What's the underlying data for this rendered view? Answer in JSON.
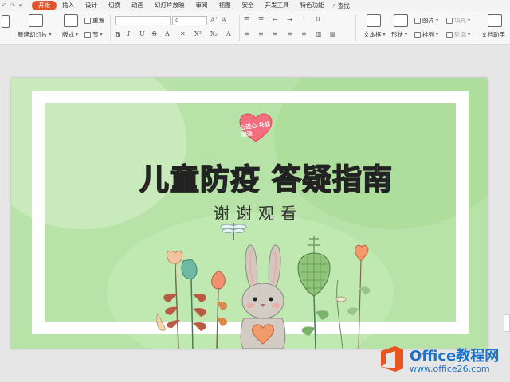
{
  "menubar": {
    "tabs": [
      "开始",
      "插入",
      "设计",
      "切换",
      "动画",
      "幻灯片放映",
      "审阅",
      "视图",
      "安全",
      "开发工具",
      "特色功能"
    ],
    "active_tab": "开始",
    "search_label": "查找",
    "accent": "#e2552b"
  },
  "ribbon": {
    "new_slide": "新建幻灯片",
    "layout": "版式",
    "reset": "重置",
    "section": "节",
    "font_size": "0",
    "textbox": "文本框",
    "shape": "形状",
    "picture": "图片",
    "arrange": "排列",
    "fill": "填充",
    "outline": "轮廓",
    "text_assistant": "文档助手"
  },
  "slide": {
    "heart_text": "心连心 共战加油",
    "title_chars": [
      "儿",
      "童",
      "防",
      "疫",
      " ",
      "答",
      "疑",
      "指",
      "南"
    ],
    "subtitle": "谢谢观看"
  },
  "watermark": {
    "name": "Office教程网",
    "url": "www.office26.com"
  }
}
